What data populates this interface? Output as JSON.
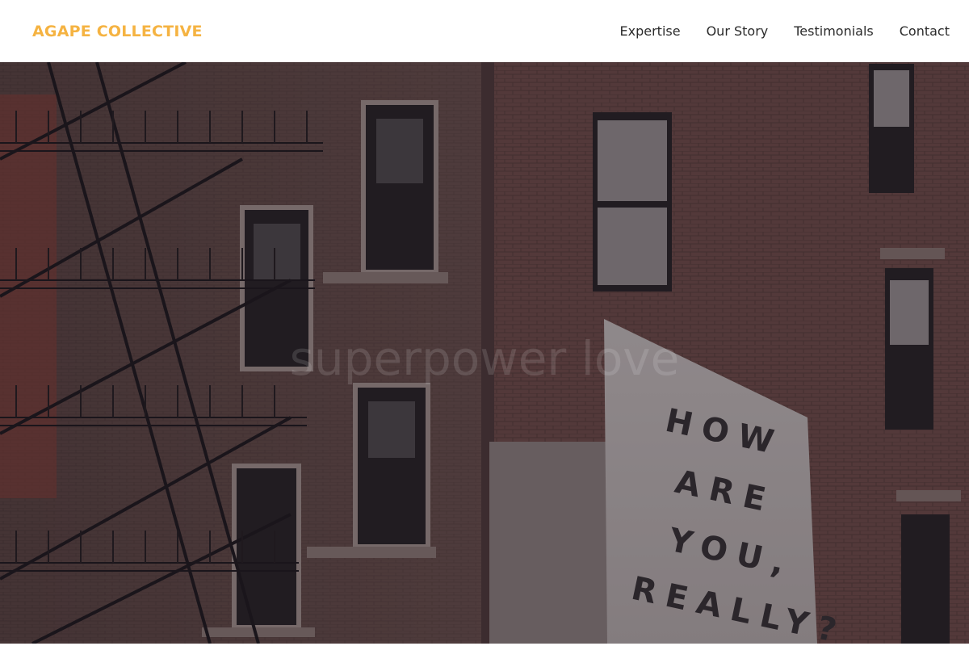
{
  "brand": {
    "name": "AGAPE COLLECTIVE",
    "color": "#f5b342"
  },
  "nav": {
    "items": [
      {
        "label": "Expertise"
      },
      {
        "label": "Our Story"
      },
      {
        "label": "Testimonials"
      },
      {
        "label": "Contact"
      }
    ]
  },
  "hero": {
    "tagline": "superpower love",
    "sign_lines": [
      "HOW",
      "ARE",
      "YOU,",
      "REALLY?"
    ]
  }
}
